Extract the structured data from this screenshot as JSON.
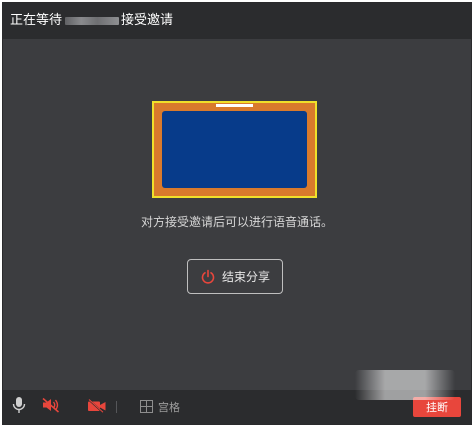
{
  "window": {
    "title_prefix": "正在等待",
    "title_suffix": "接受邀请"
  },
  "share_preview": {
    "caption": "对方接受邀请后可以进行语音通话。"
  },
  "end_share": {
    "label": "结束分享",
    "icon": "power-icon"
  },
  "toolbar": {
    "mic": "microphone-icon",
    "speaker_muted": "speaker-muted-icon",
    "camera_off": "camera-off-icon",
    "grid_label": "宫格",
    "hangup_label": "挂断"
  },
  "colors": {
    "background": "#3c3d40",
    "titlebar": "#2b2c2e",
    "preview_border": "#f0e02a",
    "preview_frame": "#d97a2c",
    "preview_screen": "#073b8a",
    "alert_red": "#e8463c"
  }
}
